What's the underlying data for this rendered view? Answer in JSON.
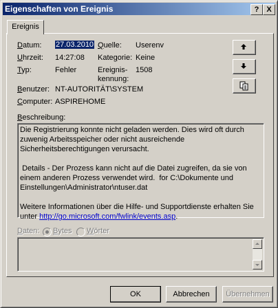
{
  "window": {
    "title": "Eigenschaften von Ereignis",
    "help_btn": "?",
    "close_btn": "X"
  },
  "tab": {
    "label": "Ereignis"
  },
  "fields": {
    "datum_label": "Datum:",
    "datum_value": "27.03.2010",
    "quelle_label": "Quelle:",
    "quelle_value": "Userenv",
    "uhrzeit_label": "Uhrzeit:",
    "uhrzeit_value": "14:27:08",
    "kategorie_label": "Kategorie:",
    "kategorie_value": "Keine",
    "typ_label": "Typ:",
    "typ_value": "Fehler",
    "ereignis_label_1": "Ereignis-",
    "ereignis_label_2": "kennung:",
    "ereignis_value": "1508",
    "benutzer_label": "Benutzer:",
    "benutzer_value": "NT-AUTORITÄT\\SYSTEM",
    "computer_label": "Computer:",
    "computer_value": "ASPIREHOME"
  },
  "side_buttons": {
    "up_icon": "arrow-up-icon",
    "down_icon": "arrow-down-icon",
    "copy_icon": "copy-icon"
  },
  "description": {
    "label": "Beschreibung:",
    "text": "Die Registrierung konnte nicht geladen werden. Dies wird oft durch zuwenig Arbeitsspeicher oder nicht ausreichende Sicherheitsberechtigungen verursacht.\n\n Details - Der Prozess kann nicht auf die Datei zugreifen, da sie von einem anderen Prozess verwendet wird.  for C:\\Dokumente und Einstellungen\\Administrator\\ntuser.dat\n\nWeitere Informationen über die Hilfe- und Supportdienste erhalten Sie unter ",
    "link": "http://go.microsoft.com/fwlink/events.asp",
    "suffix": "."
  },
  "data_section": {
    "label": "Daten:",
    "bytes": "Bytes",
    "words": "Wörter"
  },
  "footer": {
    "ok": "OK",
    "cancel": "Abbrechen",
    "apply": "Übernehmen"
  }
}
